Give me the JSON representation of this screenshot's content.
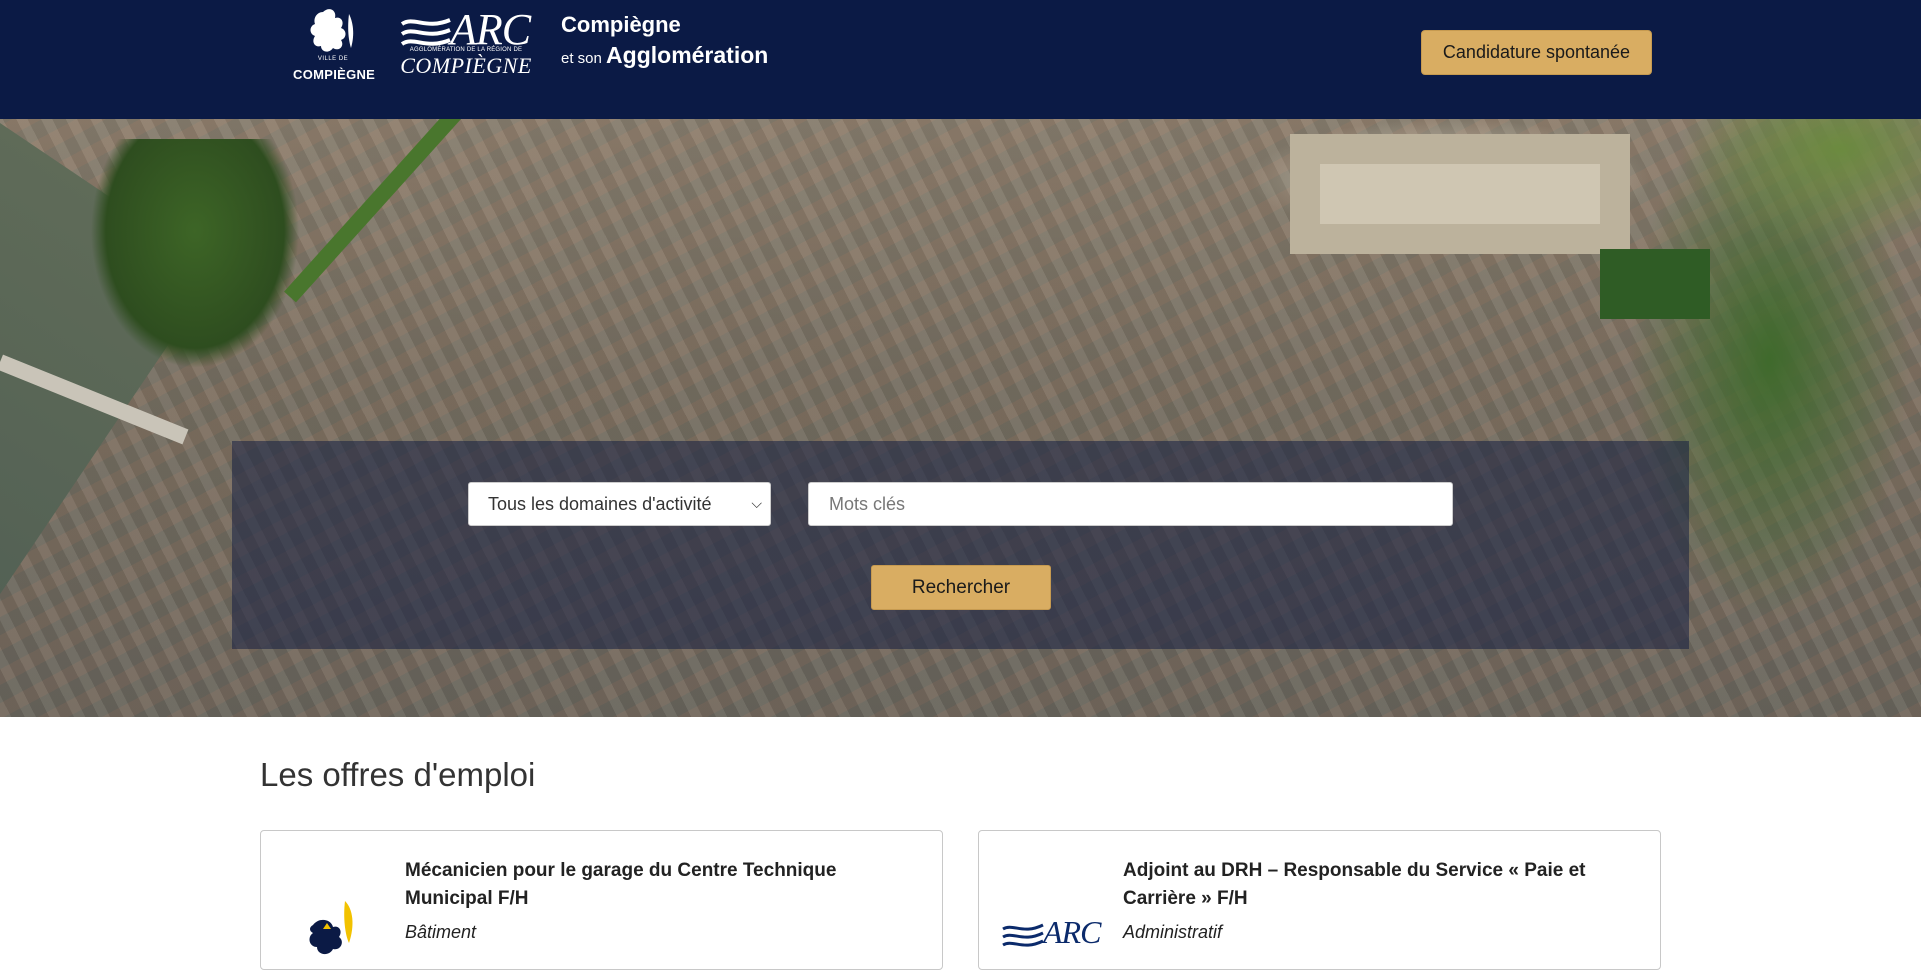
{
  "header": {
    "logo_ville_small": "VILLE DE",
    "logo_ville_big": "COMPIÈGNE",
    "logo_arc_word": "ARC",
    "logo_arc_sub": "AGGLOMÉRATION DE LA RÉGION DE",
    "logo_arc_city": "COMPIÈGNE",
    "title_line1": "Compiègne",
    "title_line2_prefix": "et son",
    "title_line2_bold": "Agglomération",
    "spontaneous_button": "Candidature spontanée"
  },
  "search": {
    "domain_select_value": "Tous les domaines d'activité",
    "keywords_placeholder": "Mots clés",
    "search_button": "Rechercher"
  },
  "offers": {
    "section_title": "Les offres d'emploi",
    "items": [
      {
        "title": "Mécanicien pour le garage du Centre Technique Municipal F/H",
        "category": "Bâtiment",
        "logo": "ville-de-compiegne-lion-logo"
      },
      {
        "title": "Adjoint au DRH – Responsable du Service « Paie et Carrière » F/H",
        "category": "Administratif",
        "logo": "arc-logo",
        "logo_text": "ARC"
      }
    ]
  },
  "colors": {
    "header_bg": "#0b1a45",
    "accent": "#d9ad62"
  }
}
